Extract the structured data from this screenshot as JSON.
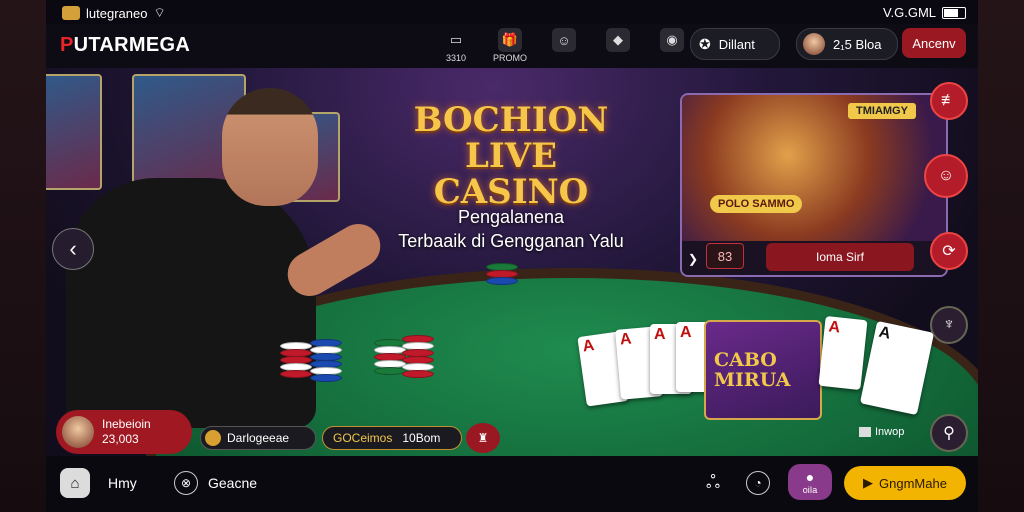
{
  "status": {
    "carrier": "lutegraneo",
    "signal": "V.G.GML"
  },
  "header": {
    "brand_prefix": "P",
    "brand_rest": "UTARMEGA",
    "nav": [
      {
        "label": "3310",
        "icon": "wallet-icon"
      },
      {
        "label": "PROMO",
        "icon": "gift-icon"
      },
      {
        "label": "",
        "icon": "user-badge-icon"
      },
      {
        "label": "",
        "icon": "card-icon"
      },
      {
        "label": "",
        "icon": "chat-icon"
      }
    ],
    "user_name": "Dillant",
    "balance": "2₁5 Bloa",
    "action_label": "Ancenv"
  },
  "hero": {
    "title_line1": "BOCHION",
    "title_line2": "LIVE CASINO",
    "subtitle_line1": "Pengalanena",
    "subtitle_line2": "Terbaaik di Gengganan Yalu",
    "game_card": {
      "tag": "TMIAMGY",
      "logo": "POLO SAMMO",
      "count": "83",
      "play_label": "Ioma Sirf"
    },
    "feature_card_title_1": "CABO",
    "feature_card_title_2": "MIRUA",
    "winner": {
      "name": "Inebeioin",
      "amount": "23,003"
    },
    "chip_info_1": "Darlogeeae",
    "chip_info_2": "GOCeimos",
    "chip_info_2b": "10Bom",
    "lobby_label": "Inwop"
  },
  "bottom_nav": {
    "home_label": "Hmy",
    "item2_label": "Geacne",
    "chat_label": "oiIa",
    "cta_label": "GngmMahe"
  }
}
